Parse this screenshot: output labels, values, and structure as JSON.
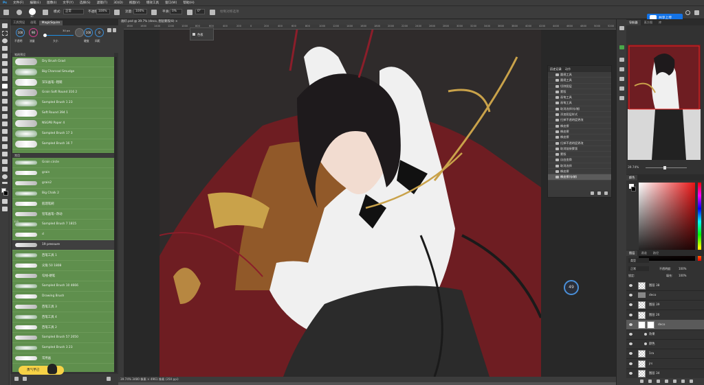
{
  "menu": [
    "文件(F)",
    "编辑(E)",
    "图像(I)",
    "文字(Y)",
    "选择(S)",
    "滤镜(T)",
    "3D(D)",
    "视图(V)",
    "增效工具",
    "窗口(W)",
    "帮助(H)"
  ],
  "options": {
    "size": "30",
    "mode_label": "模式:",
    "mode_value": "正常",
    "opacity_label": "不透明度:",
    "opacity_value": "100%",
    "flow_label": "流量:",
    "flow_value": "100%",
    "smooth_label": "平滑:",
    "smooth_value": "0%",
    "angle_value": "0°",
    "extra_label": "绘制对称选项",
    "share_label": "共享上传"
  },
  "brush_panel": {
    "tabs": [
      "工具预设",
      "画笔",
      "MagicSquire"
    ],
    "active_tab": 2,
    "opacity_circle": "100",
    "opacity_label": "不透明",
    "flow_circle": "90",
    "flow_label": "流量",
    "size_value": "30 px",
    "size_label": "大小",
    "hardness_value": "100",
    "hardness_label": "硬度",
    "ratio_value": "0",
    "ratio_label": "间距",
    "group1_label": "笔刷预设",
    "group1": [
      {
        "label": "Dry Brush Grad"
      },
      {
        "label": "Big Charcoal Smudge"
      },
      {
        "label": "深灰画笔--粗糙"
      },
      {
        "label": "Grain Soft Round 316 2"
      },
      {
        "label": "Sampled Brush 1 23"
      },
      {
        "label": "Soft Round 394 1"
      },
      {
        "label": "NSGPB Paper 4"
      },
      {
        "label": "Sampled Brush 17 3"
      },
      {
        "label": "Sampled Brush 16 7"
      }
    ],
    "group2_label": "常用",
    "group2": [
      {
        "num": "",
        "label": "Grain circle"
      },
      {
        "num": "",
        "label": "grain"
      },
      {
        "num": "",
        "label": "grain2"
      },
      {
        "num": "",
        "label": "Big Chalk 2"
      },
      {
        "num": "",
        "label": "肌理笔刷"
      },
      {
        "num": "",
        "label": "铅笔画笔--改动"
      },
      {
        "num": "125",
        "label": "Sampled Brush 7 1815"
      },
      {
        "num": "",
        "label": "d"
      },
      {
        "num": "",
        "label": "19 pressure"
      },
      {
        "num": "",
        "label": "西笔工具 1"
      },
      {
        "num": "",
        "label": "尖角 50 1808"
      },
      {
        "num": "",
        "label": "勾线-硬笔"
      },
      {
        "num": "",
        "label": "Sampled Brush 10 4666"
      },
      {
        "num": "",
        "label": "Drawing Brush"
      },
      {
        "num": "",
        "label": "西笔工具 3"
      },
      {
        "num": "",
        "label": "西笔工具 4"
      },
      {
        "num": "",
        "label": "西笔工具 2"
      },
      {
        "num": "",
        "label": "Sampled Brush 57 2050"
      },
      {
        "num": "",
        "label": "Sampled Brush 3 23"
      },
      {
        "num": "",
        "label": "常用画"
      }
    ],
    "selected_index": 8,
    "mascot_label": "勇气芋己"
  },
  "document": {
    "tab_title": "画好.psd @ 39.7% (deco, 图层蒙版/8) ×",
    "ruler_ticks": [
      "1800",
      "1600",
      "1400",
      "1200",
      "1000",
      "800",
      "600",
      "400",
      "200",
      "0",
      "200",
      "400",
      "600",
      "800",
      "1000",
      "1200",
      "1400",
      "1600",
      "1800",
      "2000",
      "2200",
      "2400",
      "2600",
      "2800",
      "3000",
      "3200",
      "3400",
      "3600",
      "3800",
      "4000",
      "4200",
      "4400",
      "4600",
      "4800",
      "5000",
      "5200"
    ],
    "status": "39.74%   3480 像素 × 4961 像素 (350 ppi)",
    "tooltip": "色板",
    "progress_badge": "49"
  },
  "history": {
    "tabs": [
      "历史记录",
      "动作"
    ],
    "items": [
      "圆规工具",
      "圆规工具",
      "切除图层",
      "蒙版",
      "画笔工具",
      "画笔工具",
      "取消选择(存储)",
      "添加图层样式",
      "扫掉不透明度更改",
      "橡皮擦",
      "橡皮擦",
      "橡皮擦",
      "扫掉不透明度更改",
      "取消链接蒙版",
      "蒙版",
      "自由变换",
      "取消选择",
      "橡皮擦",
      "橡皮擦(存储)"
    ],
    "selected_index": 18
  },
  "navigator": {
    "tabs": [
      "导航器",
      "直方图",
      "库"
    ],
    "zoom": "39.74%"
  },
  "color_panel": {
    "tabs": [
      "颜色"
    ]
  },
  "layers": {
    "tabs": [
      "图层",
      "通道",
      "路径"
    ],
    "filter_label": "类型",
    "blend": "正常",
    "opacity_label": "不透明度:",
    "opacity": "100%",
    "lock_label": "锁定:",
    "fill_label": "填充:",
    "fill": "100%",
    "items": [
      {
        "name": "图层 38",
        "kind": "thumb"
      },
      {
        "name": "deco",
        "kind": "group"
      },
      {
        "name": "图层 39",
        "kind": "thumb"
      },
      {
        "name": "图层 26",
        "kind": "thumb"
      },
      {
        "name": "deco",
        "kind": "mask"
      },
      {
        "name": "效果",
        "kind": "fx"
      },
      {
        "name": "颜色",
        "kind": "fx"
      },
      {
        "name": "1ra",
        "kind": "thumb"
      },
      {
        "name": "jrs",
        "kind": "thumb"
      },
      {
        "name": "图层 34",
        "kind": "thumb"
      }
    ]
  },
  "colors": {
    "accent": "#1473e6",
    "brush_green": "#5f8f4d",
    "canvas_red": "#6e1d22",
    "gold": "#c9a24a",
    "skin": "#f2dcd0",
    "shirt": "#f1f1f1"
  }
}
